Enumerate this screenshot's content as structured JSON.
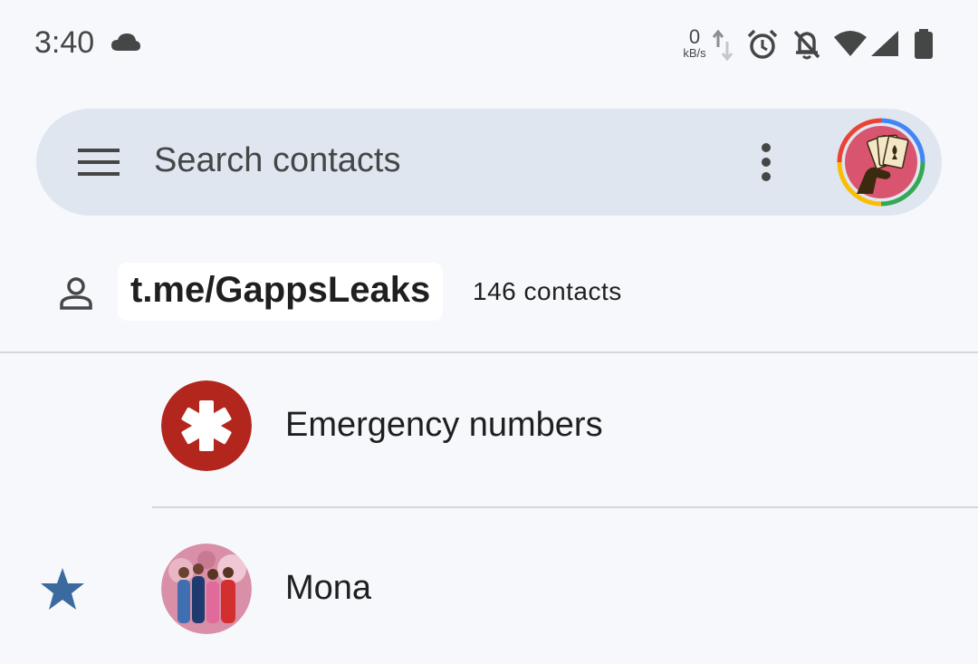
{
  "status_bar": {
    "time": "3:40",
    "net_speed_value": "0",
    "net_speed_unit": "kB/s",
    "icons": [
      "cloud-icon",
      "data-arrows-icon",
      "alarm-icon",
      "bell-off-icon",
      "wifi-icon",
      "signal-icon",
      "battery-icon"
    ]
  },
  "search": {
    "placeholder": "Search contacts",
    "menu_icon": "menu-icon",
    "more_icon": "more-vert-icon"
  },
  "account": {
    "label": "t.me/GappsLeaks",
    "count": "146 contacts",
    "icon": "person-icon"
  },
  "contacts": [
    {
      "name": "Emergency numbers",
      "starred": false,
      "avatar": "medical-asterisk-icon"
    },
    {
      "name": "Mona",
      "starred": true,
      "avatar": "photo-avatar"
    }
  ],
  "colors": {
    "background": "#f6f8fc",
    "search_bar": "#e0e6f0",
    "emergency_red": "#b3261e",
    "star_blue": "#3a6a9e",
    "text_primary": "#1f1f1f",
    "text_secondary": "#444746"
  }
}
